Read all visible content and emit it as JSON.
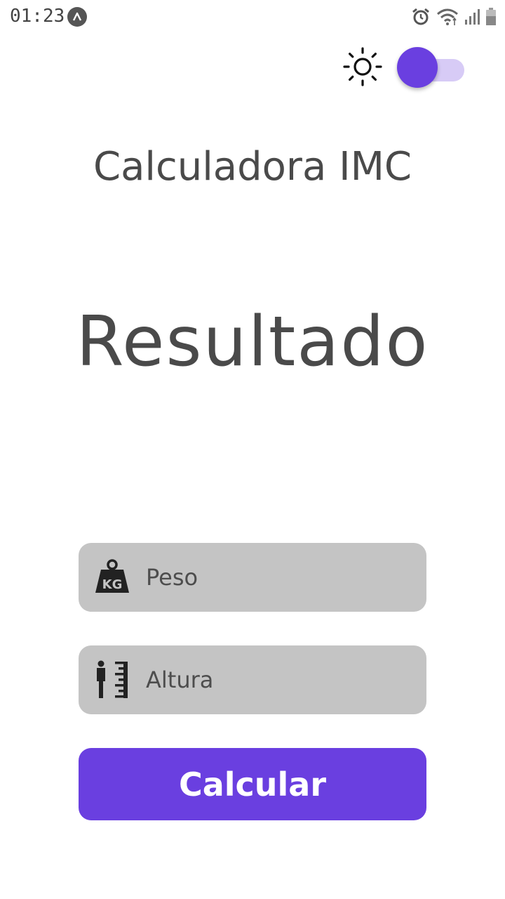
{
  "status_bar": {
    "time": "01:23",
    "app_icon": "a-logo-icon",
    "icons": [
      "alarm-icon",
      "wifi-icon",
      "signal-icon",
      "battery-icon"
    ]
  },
  "theme": {
    "icon": "sun-icon",
    "toggle_on": true,
    "accent_color": "#6a3fe0",
    "track_color": "#d7cbf6"
  },
  "header": {
    "title": "Calculadora IMC"
  },
  "result": {
    "text": "Resultado"
  },
  "form": {
    "weight": {
      "icon": "kg-weight-icon",
      "value": "",
      "placeholder": "Peso"
    },
    "height": {
      "icon": "height-ruler-icon",
      "value": "",
      "placeholder": "Altura"
    },
    "submit_label": "Calcular"
  },
  "colors": {
    "text": "#4a4a4a",
    "field_bg": "#c4c4c4",
    "button_bg": "#6a3fe0",
    "button_text": "#ffffff"
  }
}
